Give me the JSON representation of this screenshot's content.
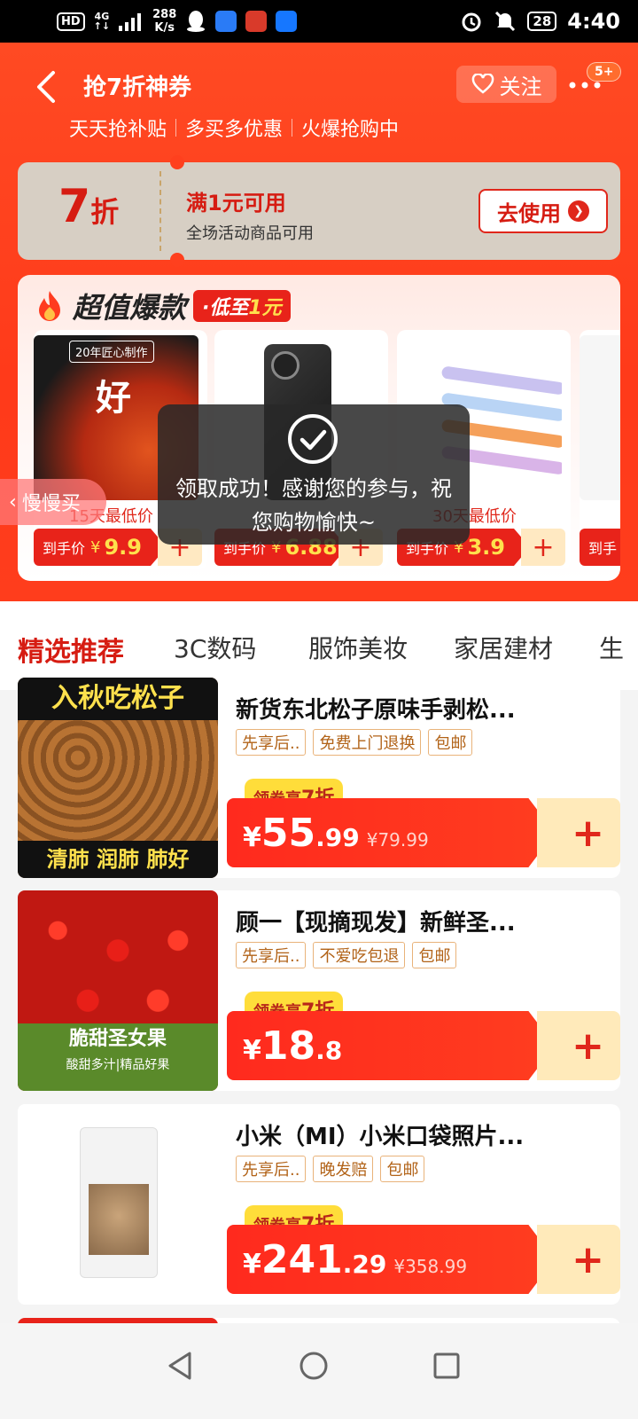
{
  "status_bar": {
    "hd": "HD",
    "net_type": "4G",
    "speed_value": "288",
    "speed_unit": "K/s",
    "battery": "28",
    "time": "4:40"
  },
  "header": {
    "title": "抢7折神券",
    "follow_label": "关注",
    "badge": "5+",
    "slogans": [
      "天天抢补贴",
      "多买多优惠",
      "火爆抢购中"
    ]
  },
  "coupon": {
    "discount_num": "7",
    "discount_unit": "折",
    "condition": "满1元可用",
    "scope": "全场活动商品可用",
    "use_label": "去使用"
  },
  "hot_deals": {
    "title": "超值爆款",
    "tag_prefix": "·低至",
    "tag_value": "1元",
    "items": [
      {
        "lowest": "15天最低价",
        "price_prefix": "到手价",
        "yen": "¥",
        "price": "9.9",
        "img_caption": "20年匠心制作"
      },
      {
        "lowest": "",
        "price_prefix": "到手价",
        "yen": "¥",
        "price": "6.88"
      },
      {
        "lowest": "30天最低价",
        "price_prefix": "到手价",
        "yen": "¥",
        "price": "3.9"
      },
      {
        "lowest": "",
        "price_prefix": "到手",
        "yen": "",
        "price": ""
      }
    ]
  },
  "toast": {
    "message": "领取成功！感谢您的参与，祝您购物愉快~"
  },
  "floating": {
    "slow_buy": "慢慢买"
  },
  "tabs": [
    "精选推荐",
    "3C数码",
    "服饰美妆",
    "家居建材",
    "生"
  ],
  "products": [
    {
      "name": "新货东北松子原味手剥松...",
      "tags": [
        "先享后..",
        "免费上门退换",
        "包邮"
      ],
      "coupon_text": "领券享",
      "coupon_value": "7折",
      "yen": "¥",
      "price_int": "55",
      "price_dec": ".99",
      "orig": "¥79.99",
      "img_top": "入秋吃松子",
      "img_bottom": "清肺 润肺 肺好"
    },
    {
      "name": "顾一【现摘现发】新鲜圣...",
      "tags": [
        "先享后..",
        "不爱吃包退",
        "包邮"
      ],
      "coupon_text": "领券享",
      "coupon_value": "7折",
      "yen": "¥",
      "price_int": "18",
      "price_dec": ".8",
      "orig": "",
      "img_caption": "脆甜圣女果",
      "img_sub": "酸甜多汁|精品好果"
    },
    {
      "name": "小米（MI）小米口袋照片...",
      "tags": [
        "先享后..",
        "晚发赔",
        "包邮"
      ],
      "coupon_text": "领券享",
      "coupon_value": "7折",
      "yen": "¥",
      "price_int": "241",
      "price_dec": ".29",
      "orig": "¥358.99"
    }
  ],
  "colors": {
    "brand_red": "#e8231a",
    "header_bg": "#ff4a23",
    "price_yellow": "#ffe14d",
    "coupon_bg": "#d7cfc4"
  }
}
